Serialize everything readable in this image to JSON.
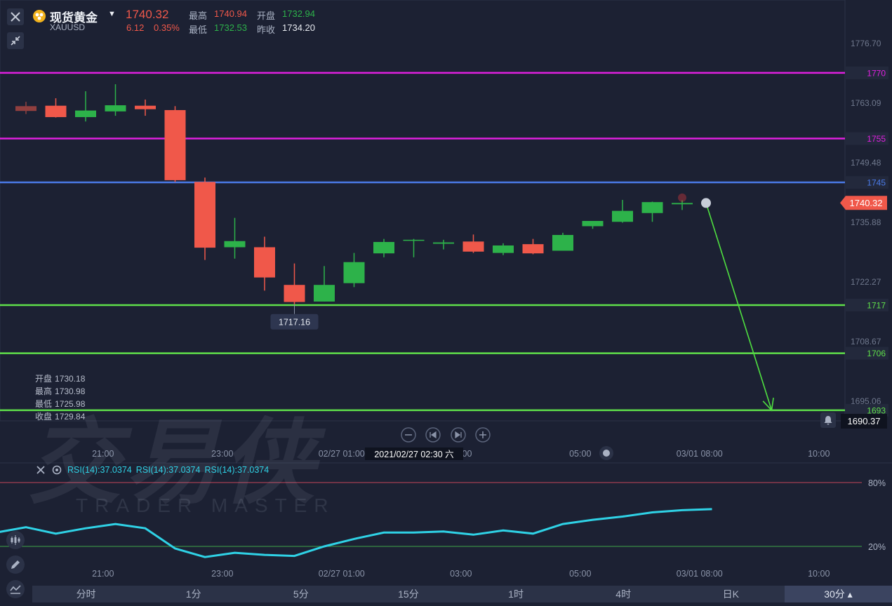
{
  "header": {
    "title": "现货黄金",
    "symbol": "XAUUSD",
    "price": "1740.32",
    "change": "6.12",
    "change_pct": "0.35%",
    "high_label": "最高",
    "high": "1740.94",
    "low_label": "最低",
    "low": "1732.53",
    "open_label": "开盘",
    "open": "1732.94",
    "prev_close_label": "昨收",
    "prev_close": "1734.20"
  },
  "ohlc_info": {
    "open_label": "开盘",
    "open": "1730.18",
    "high_label": "最高",
    "high": "1730.98",
    "low_label": "最低",
    "low": "1725.98",
    "close_label": "收盘",
    "close": "1729.84"
  },
  "rsi": {
    "labels": [
      "RSI(14):37.0374",
      "RSI(14):37.0374",
      "RSI(14):37.0374"
    ]
  },
  "timeframes": [
    {
      "label": "分时"
    },
    {
      "label": "1分"
    },
    {
      "label": "5分"
    },
    {
      "label": "15分"
    },
    {
      "label": "1时"
    },
    {
      "label": "4时"
    },
    {
      "label": "日K"
    },
    {
      "label": "30分 ▴",
      "active": true
    }
  ],
  "watermark": {
    "cn": "交易侠",
    "en": "TRADER MASTER"
  },
  "colors": {
    "up": "#f0584a",
    "down": "#2db24a",
    "background": "#1c2133",
    "rsi_line": "#2fd2e6",
    "magenta": "#e020e0",
    "blue": "#4a7ae8",
    "green": "#5fe04a"
  },
  "chart_data": {
    "type": "candlestick",
    "y_axis": {
      "range": [
        1688,
        1782
      ],
      "ticks": [
        "1776.70",
        "1763.09",
        "1749.48",
        "1735.88",
        "1722.27",
        "1708.67",
        "1695.06"
      ]
    },
    "x_axis": {
      "ticks": [
        {
          "label": "21:00",
          "index": 2.3
        },
        {
          "label": "23:00",
          "index": 6.3
        },
        {
          "label": "02/27 01:00",
          "index": 10.3
        },
        {
          "label": "03:00",
          "index": 14.3
        },
        {
          "label": "05:00",
          "index": 18.3
        },
        {
          "label": "03/01 08:00",
          "index": 22.3
        },
        {
          "label": "10:00",
          "index": 26.3
        }
      ],
      "crosshair_label": "2021/02/27 02:30 六"
    },
    "current_price": "1740.32",
    "crosshair_price": "1690.37",
    "low_marker": "1717.16",
    "candles": [
      {
        "open": 1762.4,
        "high": 1763.4,
        "low": 1760.6,
        "close": 1761.3
      },
      {
        "open": 1762.5,
        "high": 1764.2,
        "low": 1759.8,
        "close": 1759.9
      },
      {
        "open": 1759.9,
        "high": 1765.8,
        "low": 1758.9,
        "close": 1761.4
      },
      {
        "open": 1761.2,
        "high": 1767.4,
        "low": 1760.2,
        "close": 1762.6
      },
      {
        "open": 1762.5,
        "high": 1763.9,
        "low": 1760.2,
        "close": 1761.7
      },
      {
        "open": 1761.5,
        "high": 1762.4,
        "low": 1745.1,
        "close": 1745.5
      },
      {
        "open": 1745.1,
        "high": 1746.1,
        "low": 1727.3,
        "close": 1730.1
      },
      {
        "open": 1730.2,
        "high": 1736.9,
        "low": 1727.6,
        "close": 1731.6
      },
      {
        "open": 1730.2,
        "high": 1732.6,
        "low": 1720.3,
        "close": 1723.3
      },
      {
        "open": 1721.6,
        "high": 1726.5,
        "low": 1717.2,
        "close": 1717.7
      },
      {
        "open": 1717.8,
        "high": 1725.9,
        "low": 1717.8,
        "close": 1721.6
      },
      {
        "open": 1722.0,
        "high": 1728.9,
        "low": 1721.1,
        "close": 1726.8
      },
      {
        "open": 1728.8,
        "high": 1732.1,
        "low": 1727.9,
        "close": 1731.4
      },
      {
        "open": 1731.8,
        "high": 1732.1,
        "low": 1727.9,
        "close": 1731.9
      },
      {
        "open": 1731.0,
        "high": 1731.9,
        "low": 1729.7,
        "close": 1731.3
      },
      {
        "open": 1731.5,
        "high": 1733.1,
        "low": 1728.9,
        "close": 1729.2
      },
      {
        "open": 1728.9,
        "high": 1731.1,
        "low": 1728.4,
        "close": 1730.6
      },
      {
        "open": 1730.9,
        "high": 1732.1,
        "low": 1728.6,
        "close": 1728.8
      },
      {
        "open": 1729.4,
        "high": 1733.5,
        "low": 1729.4,
        "close": 1733.0
      },
      {
        "open": 1735.0,
        "high": 1736.1,
        "low": 1734.4,
        "close": 1736.2
      },
      {
        "open": 1736.0,
        "high": 1741.0,
        "low": 1735.8,
        "close": 1738.5
      },
      {
        "open": 1738.0,
        "high": 1740.6,
        "low": 1736.0,
        "close": 1740.5
      },
      {
        "open": 1740.0,
        "high": 1740.9,
        "low": 1738.7,
        "close": 1740.3
      }
    ],
    "horizontal_lines": [
      {
        "value": 1770,
        "label": "1770",
        "color": "#e020e0"
      },
      {
        "value": 1755,
        "label": "1755",
        "color": "#e020e0"
      },
      {
        "value": 1745,
        "label": "1745",
        "color": "#4a7ae8"
      },
      {
        "value": 1717,
        "label": "1717",
        "color": "#5fe04a"
      },
      {
        "value": 1706,
        "label": "1706",
        "color": "#5fe04a"
      },
      {
        "value": 1693,
        "label": "1693",
        "color": "#5fe04a"
      }
    ],
    "arrow": {
      "from_index": 22.8,
      "from_value": 1740.3,
      "to_index": 25.0,
      "to_value": 1693.0
    },
    "rsi": {
      "values": [
        33,
        38,
        32,
        37,
        41,
        37,
        18,
        10,
        14,
        12,
        11,
        20,
        27,
        33,
        33,
        34,
        31,
        35,
        32,
        41,
        45,
        48,
        52,
        54,
        55
      ],
      "levels": [
        {
          "value": 80,
          "label": "80%"
        },
        {
          "value": 20,
          "label": "20%"
        }
      ]
    }
  }
}
